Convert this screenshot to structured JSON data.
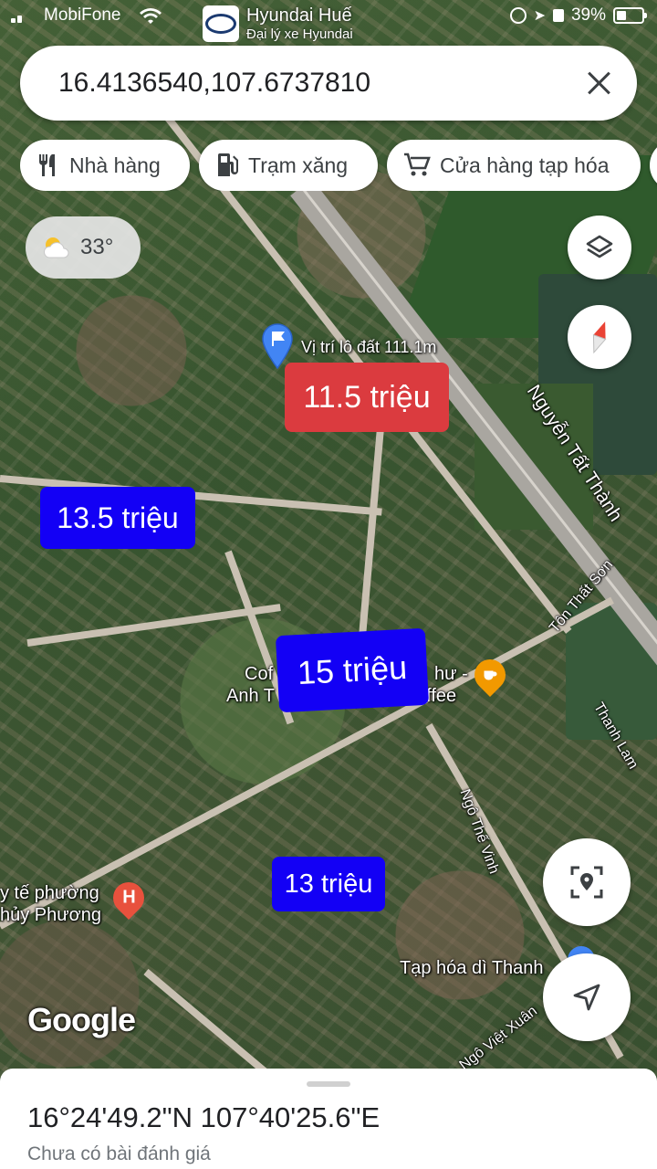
{
  "status_bar": {
    "carrier": "MobiFone",
    "battery": "39%"
  },
  "dealer": {
    "name": "Hyundai Huế",
    "subtitle": "Đại lý xe Hyundai"
  },
  "search": {
    "value": "16.4136540,107.6737810",
    "close_icon": "close-icon"
  },
  "chips": [
    {
      "label": "Nhà hàng",
      "icon": "fork-knife-icon"
    },
    {
      "label": "Trạm xăng",
      "icon": "gas-station-icon"
    },
    {
      "label": "Cửa hàng tạp hóa",
      "icon": "shopping-cart-icon"
    }
  ],
  "weather": {
    "temperature": "33°",
    "icon": "partly-sunny-icon"
  },
  "pin": {
    "label": "Vị trí lô đất 111.1m",
    "icon": "flag-pin-icon"
  },
  "price_tags": [
    {
      "label": "11.5 triệu",
      "color": "#db3b3f"
    },
    {
      "label": "13.5 triệu",
      "color": "#1300f5"
    },
    {
      "label": "15 triệu",
      "color": "#1300f5"
    },
    {
      "label": "13 triệu",
      "color": "#1300f5"
    }
  ],
  "streets": {
    "nguyen_tat_thanh": "Nguyễn Tất Thành",
    "ton_that_son": "Tôn Thất Sơn",
    "thanh_lam": "Thanh Lam",
    "ngo_the_vinh": "Ngô Thế Vinh",
    "ngo_viet_xuan": "Ngô Việt Xuân"
  },
  "pois": {
    "coffee_left_line1": "Cof",
    "coffee_left_line2": "Anh T",
    "coffee_right_line1": "hư -",
    "coffee_right_line2": "offee",
    "clinic_line1": "y tế phường",
    "clinic_line2": "hủy Phương",
    "grocery": "Tạp hóa dì Thanh"
  },
  "google_logo": "Google",
  "sheet": {
    "coordinates": "16°24'49.2\"N 107°40'25.6\"E",
    "reviews": "Chưa có bài đánh giá"
  },
  "colors": {
    "red_tag": "#db3b3f",
    "blue_tag": "#1300f5",
    "pin_blue": "#4285f4",
    "cafe_orange": "#f29900",
    "hospital_red": "#e8513d"
  }
}
